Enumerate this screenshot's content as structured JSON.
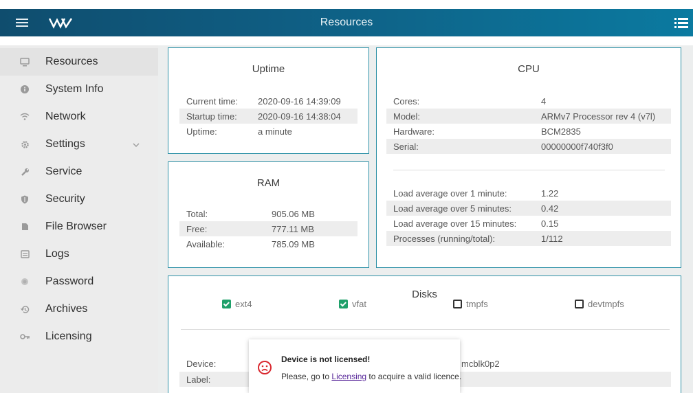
{
  "header": {
    "title": "Resources"
  },
  "sidebar": {
    "items": [
      {
        "label": "Resources",
        "icon": "monitor-icon"
      },
      {
        "label": "System Info",
        "icon": "info-icon"
      },
      {
        "label": "Network",
        "icon": "wifi-icon"
      },
      {
        "label": "Settings",
        "icon": "gear-icon"
      },
      {
        "label": "Service",
        "icon": "wrench-icon"
      },
      {
        "label": "Security",
        "icon": "shield-icon"
      },
      {
        "label": "File Browser",
        "icon": "folder-icon"
      },
      {
        "label": "Logs",
        "icon": "log-icon"
      },
      {
        "label": "Password",
        "icon": "key-icon"
      },
      {
        "label": "Archives",
        "icon": "history-icon"
      },
      {
        "label": "Licensing",
        "icon": "key-icon"
      }
    ]
  },
  "uptime": {
    "title": "Uptime",
    "rows": [
      {
        "label": "Current time:",
        "value": "2020-09-16 14:39:09"
      },
      {
        "label": "Startup time:",
        "value": "2020-09-16 14:38:04"
      },
      {
        "label": "Uptime:",
        "value": "a minute"
      }
    ]
  },
  "ram": {
    "title": "RAM",
    "rows": [
      {
        "label": "Total:",
        "value": "905.06 MB"
      },
      {
        "label": "Free:",
        "value": "777.11 MB"
      },
      {
        "label": "Available:",
        "value": "785.09 MB"
      }
    ]
  },
  "cpu": {
    "title": "CPU",
    "rows": [
      {
        "label": "Cores:",
        "value": "4"
      },
      {
        "label": "Model:",
        "value": "ARMv7 Processor rev 4 (v7l)"
      },
      {
        "label": "Hardware:",
        "value": "BCM2835"
      },
      {
        "label": "Serial:",
        "value": "00000000f740f3f0"
      }
    ],
    "load_rows": [
      {
        "label": "Load average over 1 minute:",
        "value": "1.22"
      },
      {
        "label": "Load average over 5 minutes:",
        "value": "0.42"
      },
      {
        "label": "Load average over 15 minutes:",
        "value": "0.15"
      },
      {
        "label": "Processes (running/total):",
        "value": "1/112"
      }
    ]
  },
  "disks": {
    "title": "Disks",
    "filters": [
      {
        "label": "ext4",
        "checked": true
      },
      {
        "label": "vfat",
        "checked": true
      },
      {
        "label": "tmpfs",
        "checked": false
      },
      {
        "label": "devtmpfs",
        "checked": false
      }
    ],
    "rows": [
      {
        "label": "Device:",
        "value": "mcblk0p2"
      },
      {
        "label": "Label:",
        "value": ""
      }
    ]
  },
  "toast": {
    "title": "Device is not licensed!",
    "message_before": "Please, go to ",
    "link": "Licensing",
    "message_after": " to acquire a valid licence."
  },
  "colors": {
    "accent": "#2a8fa5",
    "header": "#0f5d82",
    "check": "#1fa06a"
  }
}
